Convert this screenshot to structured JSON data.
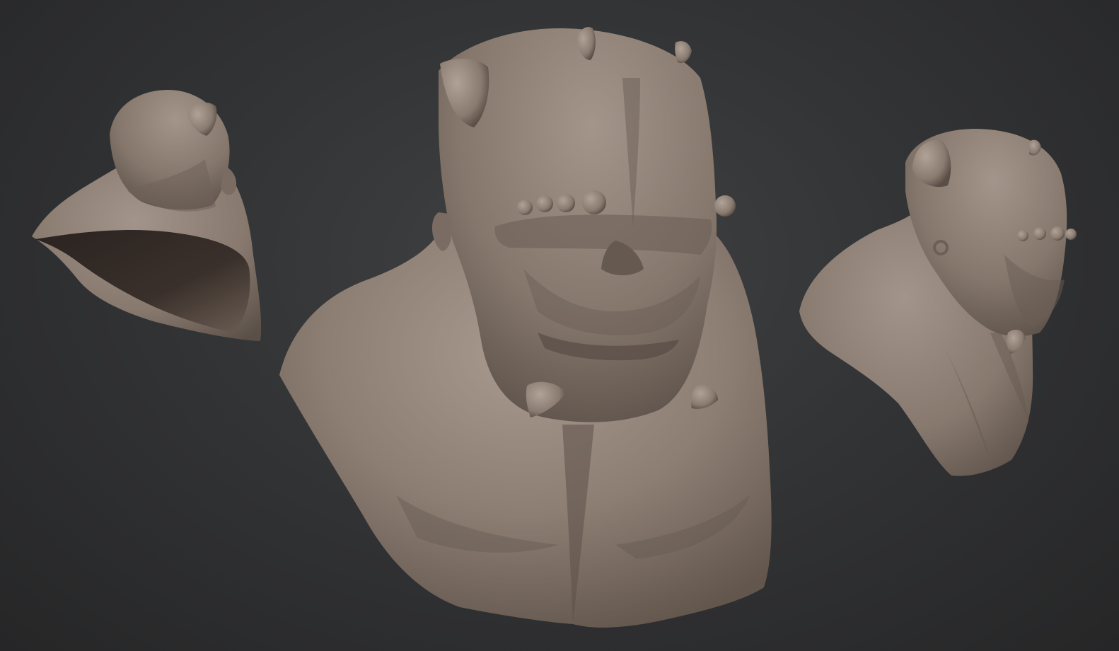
{
  "viewport": {
    "background_color": "#2b2b2c",
    "material_color": "#8a7b70",
    "material_highlight": "#a99a8e",
    "material_shadow": "#4f443d"
  },
  "models": [
    {
      "view": "back-three-quarter",
      "icon": "sculpt-bust-back"
    },
    {
      "view": "front",
      "icon": "sculpt-bust-front"
    },
    {
      "view": "side-three-quarter",
      "icon": "sculpt-bust-side"
    }
  ]
}
